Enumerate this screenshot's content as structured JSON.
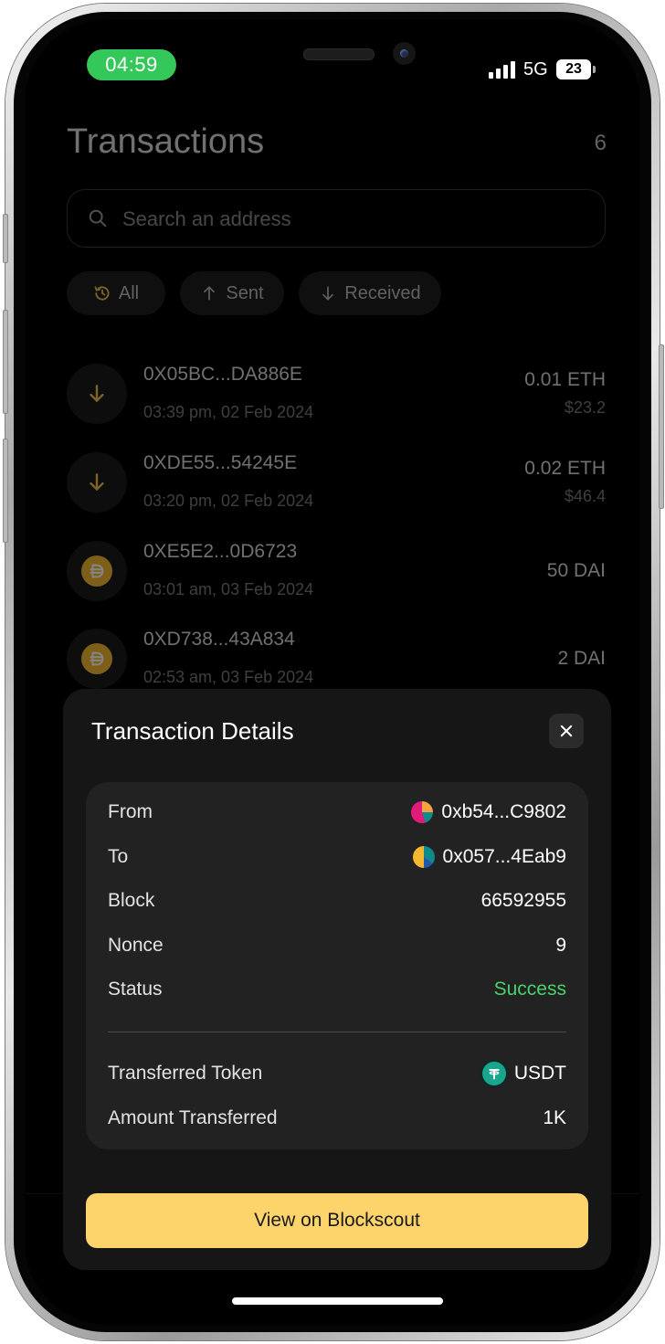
{
  "status_bar": {
    "time": "04:59",
    "network": "5G",
    "battery": "23"
  },
  "header": {
    "title": "Transactions",
    "count": "6"
  },
  "search": {
    "placeholder": "Search an address"
  },
  "filters": [
    {
      "label": "All",
      "icon": "history-icon"
    },
    {
      "label": "Sent",
      "icon": "arrow-up-icon"
    },
    {
      "label": "Received",
      "icon": "arrow-down-icon"
    }
  ],
  "transactions": [
    {
      "address": "0X05BC...DA886E",
      "time": "03:39 pm,  02 Feb 2024",
      "amount": "0.01 ETH",
      "usd": "$23.2",
      "icon": "arrow-down-icon"
    },
    {
      "address": "0XDE55...54245E",
      "time": "03:20 pm,  02 Feb 2024",
      "amount": "0.02 ETH",
      "usd": "$46.4",
      "icon": "arrow-down-icon"
    },
    {
      "address": "0XE5E2...0D6723",
      "time": "03:01 am,  03 Feb 2024",
      "amount": "50 DAI",
      "usd": "",
      "icon": "dai-icon"
    },
    {
      "address": "0XD738...43A834",
      "time": "02:53 am,  03 Feb 2024",
      "amount": "2 DAI",
      "usd": "",
      "icon": "dai-icon"
    }
  ],
  "details": {
    "title": "Transaction Details",
    "rows": [
      {
        "label": "From",
        "value": "0xb54...C9802"
      },
      {
        "label": "To",
        "value": "0x057...4Eab9"
      },
      {
        "label": "Block",
        "value": "66592955"
      },
      {
        "label": "Nonce",
        "value": "9"
      },
      {
        "label": "Status",
        "value": "Success"
      }
    ],
    "token": {
      "label": "Transferred Token",
      "value": "USDT"
    },
    "amount": {
      "label": "Amount Transferred",
      "value": "1K"
    },
    "cta": "View on Blockscout"
  },
  "colors": {
    "status_green": "#46d36a",
    "cta_yellow": "#fdd46c",
    "time_pill": "#34c759"
  }
}
